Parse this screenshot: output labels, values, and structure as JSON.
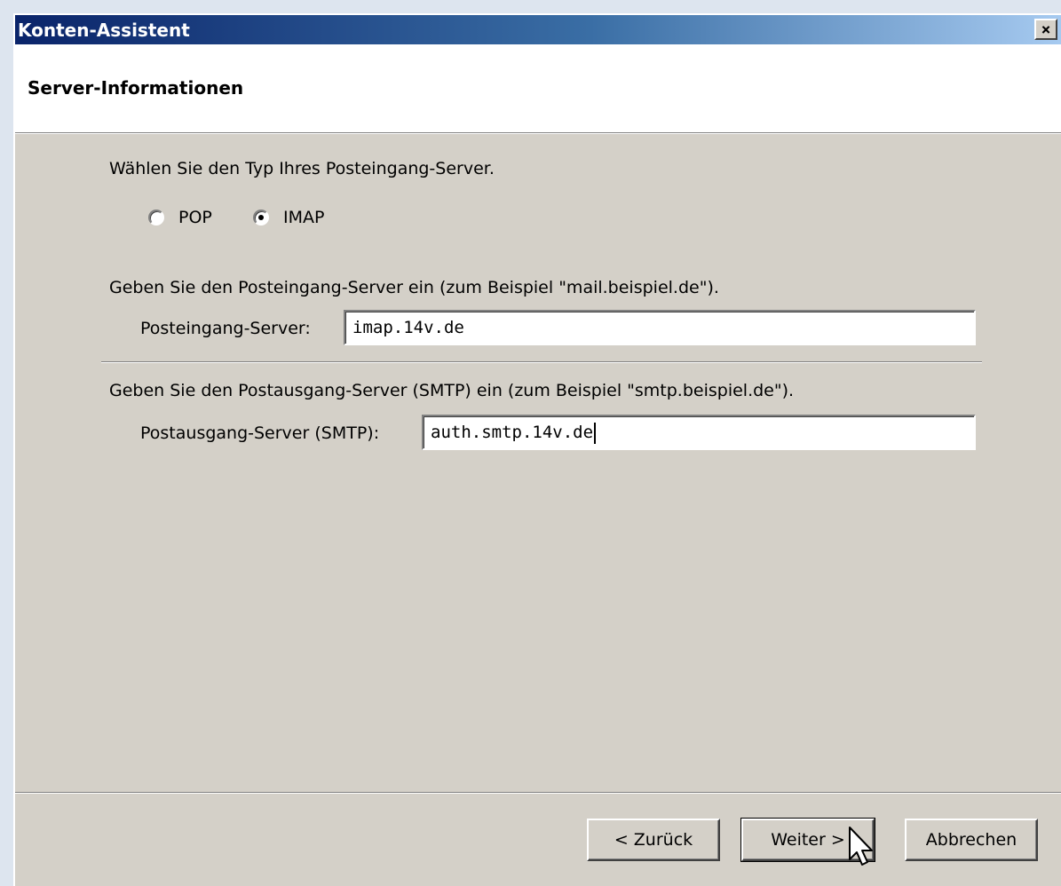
{
  "window": {
    "title": "Konten-Assistent",
    "close_icon": "close-icon",
    "close_glyph": "×"
  },
  "header": {
    "title": "Server-Informationen"
  },
  "incoming_type": {
    "prompt": "Wählen Sie den Typ Ihres Posteingang-Server.",
    "options": [
      {
        "label": "POP",
        "selected": false
      },
      {
        "label": "IMAP",
        "selected": true
      }
    ]
  },
  "incoming_server": {
    "prompt": "Geben Sie den Posteingang-Server ein (zum Beispiel \"mail.beispiel.de\").",
    "label": "Posteingang-Server:",
    "value": "imap.14v.de"
  },
  "outgoing_server": {
    "prompt": "Geben Sie den Postausgang-Server (SMTP) ein (zum Beispiel \"smtp.beispiel.de\").",
    "label": "Postausgang-Server (SMTP):",
    "value": "auth.smtp.14v.de"
  },
  "buttons": {
    "back": "< Zurück",
    "next": "Weiter >",
    "cancel": "Abbrechen"
  },
  "colors": {
    "titlebar_start": "#0a246a",
    "titlebar_end": "#a6caf0",
    "dialog_face": "#d4d0c8"
  }
}
